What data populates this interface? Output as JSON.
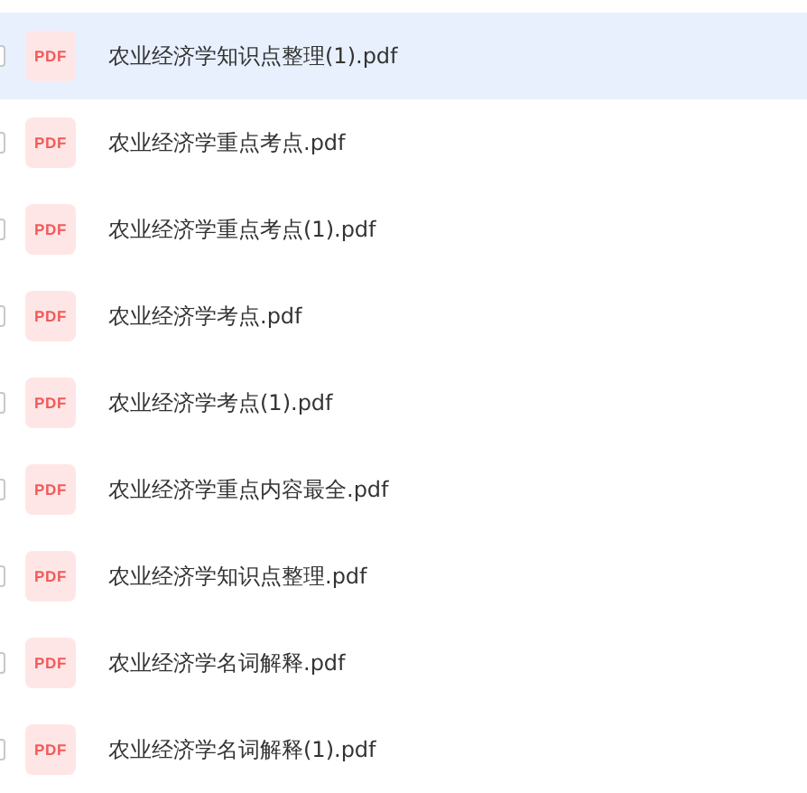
{
  "files": [
    {
      "icon_label": "PDF",
      "name": "农业经济学知识点整理(1).pdf",
      "selected": true,
      "checked": false
    },
    {
      "icon_label": "PDF",
      "name": "农业经济学重点考点.pdf",
      "selected": false,
      "checked": false
    },
    {
      "icon_label": "PDF",
      "name": "农业经济学重点考点(1).pdf",
      "selected": false,
      "checked": false
    },
    {
      "icon_label": "PDF",
      "name": "农业经济学考点.pdf",
      "selected": false,
      "checked": false
    },
    {
      "icon_label": "PDF",
      "name": "农业经济学考点(1).pdf",
      "selected": false,
      "checked": false
    },
    {
      "icon_label": "PDF",
      "name": "农业经济学重点内容最全.pdf",
      "selected": false,
      "checked": false
    },
    {
      "icon_label": "PDF",
      "name": "农业经济学知识点整理.pdf",
      "selected": false,
      "checked": false
    },
    {
      "icon_label": "PDF",
      "name": "农业经济学名词解释.pdf",
      "selected": false,
      "checked": false
    },
    {
      "icon_label": "PDF",
      "name": "农业经济学名词解释(1).pdf",
      "selected": false,
      "checked": false
    }
  ]
}
